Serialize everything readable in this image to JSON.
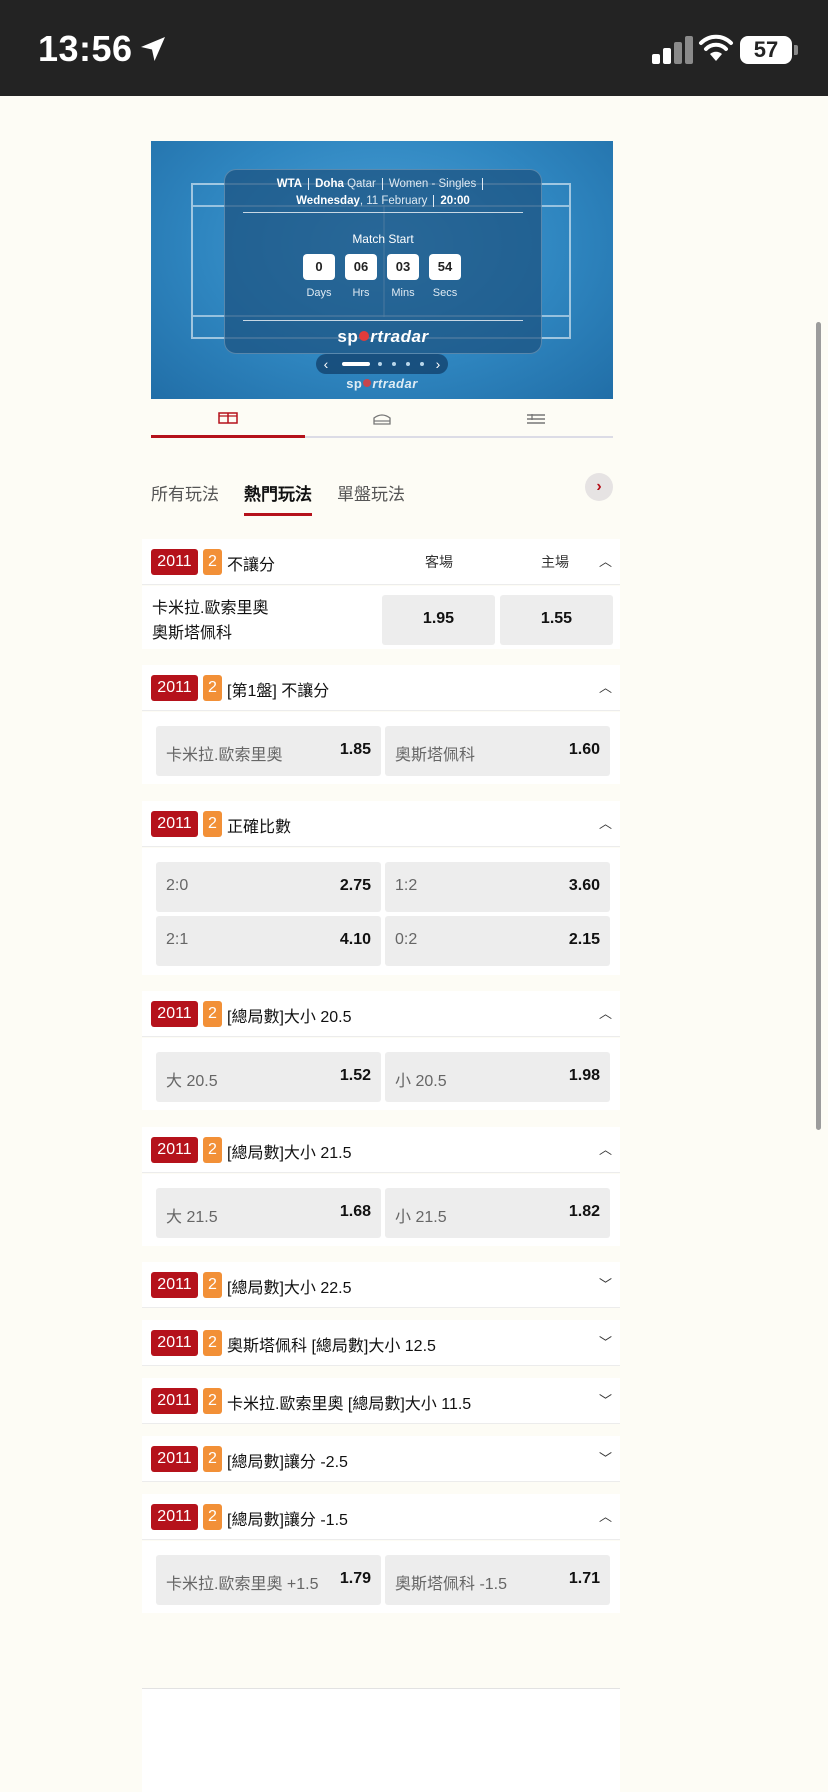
{
  "status_bar": {
    "time": "13:56",
    "battery": "57"
  },
  "widget": {
    "tour": "WTA",
    "city": "Doha",
    "country": "Qatar",
    "category": "Women - Singles",
    "weekday": "Wednesday",
    "date": ", 11 February",
    "time": "20:00",
    "match_start": "Match Start",
    "countdown": [
      {
        "value": "0",
        "label": "Days"
      },
      {
        "value": "06",
        "label": "Hrs"
      },
      {
        "value": "03",
        "label": "Mins"
      },
      {
        "value": "54",
        "label": "Secs"
      }
    ],
    "logo_pre": "sp",
    "logo_mid": "rt",
    "logo_post": "radar"
  },
  "icon_tabs": [
    "court-icon",
    "scoreboard-icon",
    "list-icon"
  ],
  "market_tabs": [
    "所有玩法",
    "熱門玩法",
    "單盤玩法"
  ],
  "market_tab_active": "熱門玩法",
  "badge_a": "2011",
  "badge_b": "2",
  "markets": {
    "m1": {
      "title": "不讓分",
      "away_label": "客場",
      "home_label": "主場",
      "team1": "卡米拉.歐索里奧",
      "team2": "奧斯塔佩科",
      "away_odds": "1.95",
      "home_odds": "1.55"
    },
    "m2": {
      "title": "[第1盤] 不讓分",
      "sel1": "卡米拉.歐索里奧",
      "odd1": "1.85",
      "sel2": "奧斯塔佩科",
      "odd2": "1.60"
    },
    "m3": {
      "title": "正確比數",
      "sel1": "2:0",
      "odd1": "2.75",
      "sel2": "1:2",
      "odd2": "3.60",
      "sel3": "2:1",
      "odd3": "4.10",
      "sel4": "0:2",
      "odd4": "2.15"
    },
    "m4": {
      "title": "[總局數]大小 20.5",
      "sel1": "大 20.5",
      "odd1": "1.52",
      "sel2": "小 20.5",
      "odd2": "1.98"
    },
    "m5": {
      "title": "[總局數]大小 21.5",
      "sel1": "大 21.5",
      "odd1": "1.68",
      "sel2": "小 21.5",
      "odd2": "1.82"
    },
    "m6": {
      "title": "[總局數]大小 22.5"
    },
    "m7": {
      "title": "奧斯塔佩科 [總局數]大小 12.5"
    },
    "m8": {
      "title": "卡米拉.歐索里奧 [總局數]大小 11.5"
    },
    "m9": {
      "title": "[總局數]讓分 -2.5"
    },
    "m10": {
      "title": "[總局數]讓分 -1.5",
      "sel1": "卡米拉.歐索里奧 +1.5",
      "odd1": "1.79",
      "sel2": "奧斯塔佩科 -1.5",
      "odd2": "1.71"
    }
  },
  "colors": {
    "brand_red": "#b5121b",
    "badge_orange": "#f29037",
    "widget_blue": "#2f86c0"
  }
}
